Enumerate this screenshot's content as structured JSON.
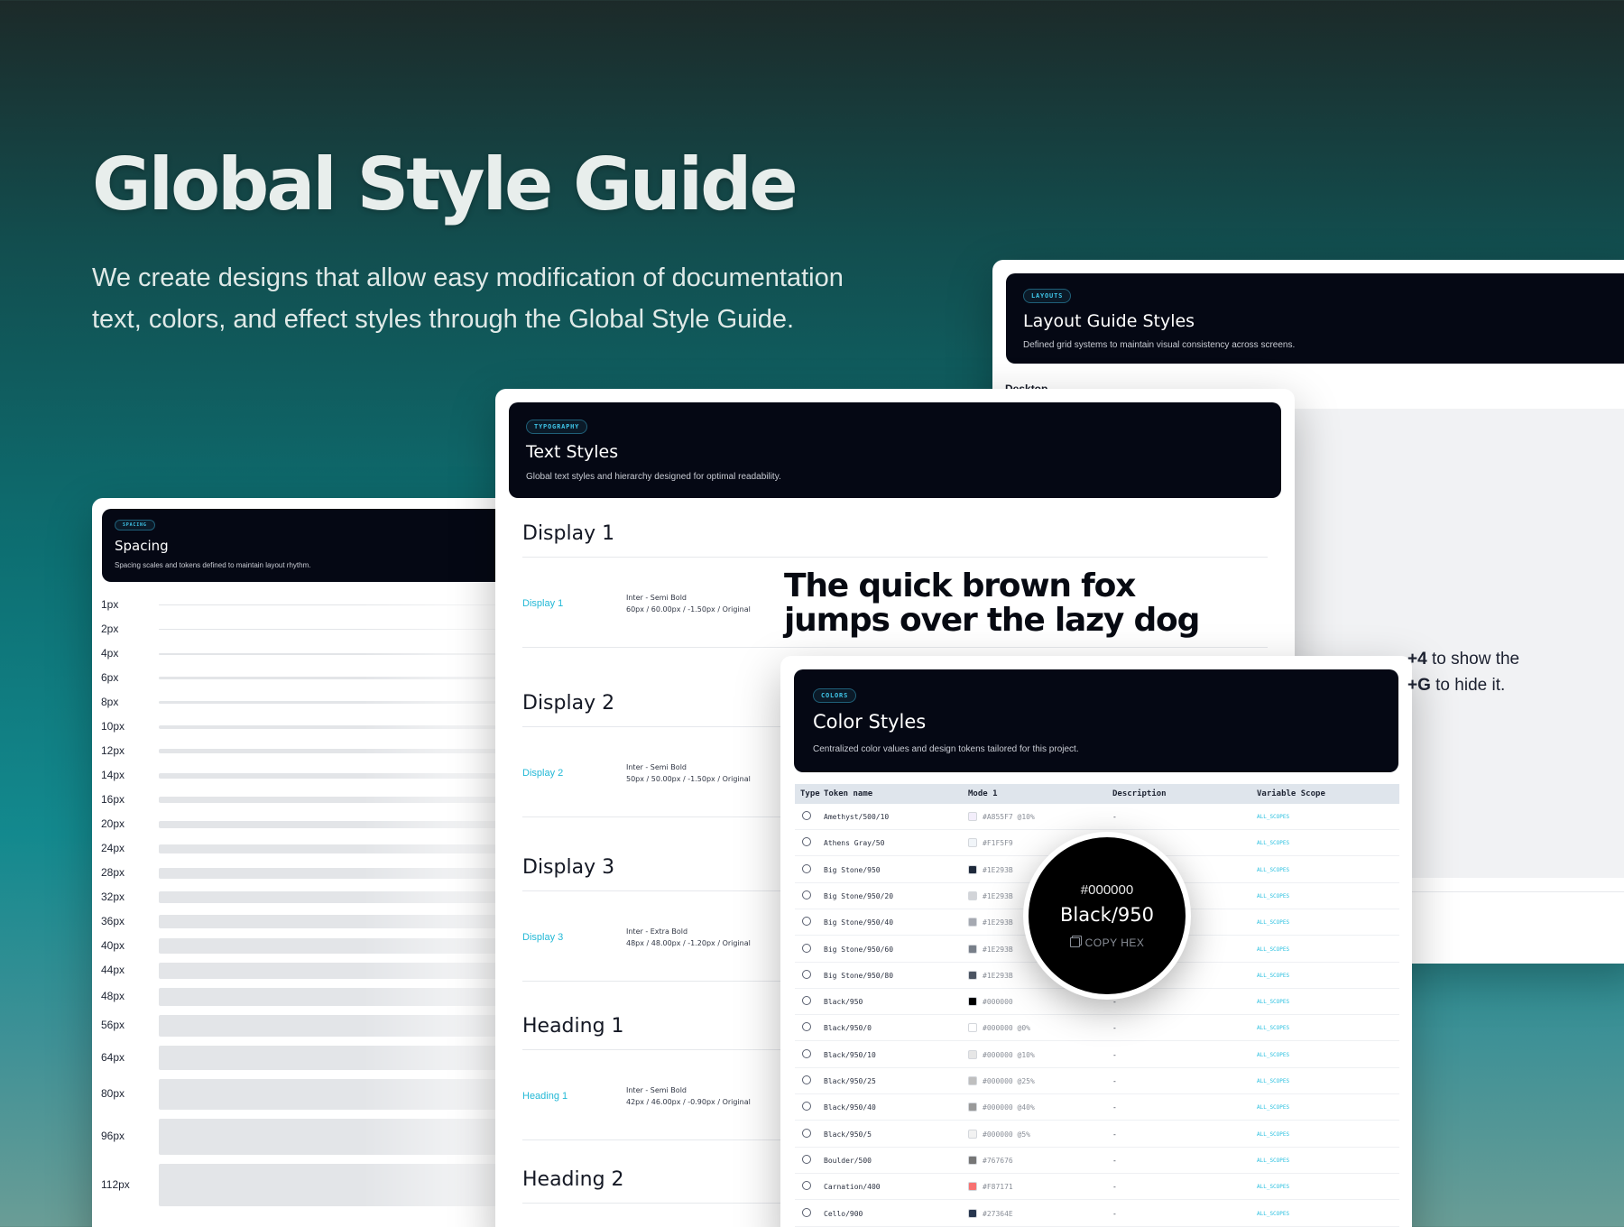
{
  "hero": {
    "title": "Global Style Guide",
    "subtitle_line1": "We create designs that allow easy modification of documentation",
    "subtitle_line2": "text, colors, and effect styles through the Global Style Guide."
  },
  "spacing_panel": {
    "tag": "SPACING",
    "title": "Spacing",
    "description": "Spacing scales and tokens defined to maintain layout rhythm.",
    "items": [
      "1px",
      "2px",
      "4px",
      "6px",
      "8px",
      "10px",
      "12px",
      "14px",
      "16px",
      "20px",
      "24px",
      "28px",
      "32px",
      "36px",
      "40px",
      "44px",
      "48px",
      "56px",
      "64px",
      "80px",
      "96px",
      "112px"
    ]
  },
  "layout_panel": {
    "tag": "LAYOUTS",
    "title": "Layout Guide Styles",
    "description": "Defined grid systems to maintain visual consistency across screens.",
    "section_label": "Desktop"
  },
  "text_panel": {
    "tag": "TYPOGRAPHY",
    "title": "Text Styles",
    "description": "Global text styles and hierarchy designed for optimal readability.",
    "sample": "The quick brown fox jumps over the lazy dog",
    "styles": [
      {
        "heading": "Display 1",
        "link": "Display 1",
        "font": "Inter - Semi Bold",
        "spec": "60px / 60.00px / -1.50px / Original"
      },
      {
        "heading": "Display 2",
        "link": "Display 2",
        "font": "Inter - Semi Bold",
        "spec": "50px / 50.00px / -1.50px / Original"
      },
      {
        "heading": "Display 3",
        "link": "Display 3",
        "font": "Inter - Extra Bold",
        "spec": "48px / 48.00px / -1.20px / Original"
      },
      {
        "heading": "Heading 1",
        "link": "Heading 1",
        "font": "Inter - Semi Bold",
        "spec": "42px / 46.00px / -0.90px / Original"
      },
      {
        "heading": "Heading 2",
        "link": "",
        "font": "",
        "spec": ""
      }
    ]
  },
  "color_panel": {
    "tag": "COLORS",
    "title": "Color Styles",
    "description": "Centralized color values and design tokens tailored for this project.",
    "columns": {
      "type": "Type",
      "token": "Token name",
      "mode": "Mode 1",
      "description": "Description",
      "scope": "Variable Scope"
    },
    "rows": [
      {
        "token": "Amethyst/500/10",
        "value": "#A855F7 @10%",
        "swatch": "#f3eefb",
        "desc": "-",
        "scope": "ALL_SCOPES"
      },
      {
        "token": "Athens Gray/50",
        "value": "#F1F5F9",
        "swatch": "#F1F5F9",
        "desc": "-",
        "scope": "ALL_SCOPES"
      },
      {
        "token": "Big Stone/950",
        "value": "#1E293B",
        "swatch": "#1E293B",
        "desc": "-",
        "scope": "ALL_SCOPES"
      },
      {
        "token": "Big Stone/950/20",
        "value": "#1E293B",
        "swatch": "#d2d4d8",
        "desc": "-",
        "scope": "ALL_SCOPES"
      },
      {
        "token": "Big Stone/950/40",
        "value": "#1E293B",
        "swatch": "#a5a9b1",
        "desc": "-",
        "scope": "ALL_SCOPES"
      },
      {
        "token": "Big Stone/950/60",
        "value": "#1E293B",
        "swatch": "#787f89",
        "desc": "-",
        "scope": "ALL_SCOPES"
      },
      {
        "token": "Big Stone/950/80",
        "value": "#1E293B",
        "swatch": "#4b5462",
        "desc": "-",
        "scope": "ALL_SCOPES"
      },
      {
        "token": "Black/950",
        "value": "#000000",
        "swatch": "#000000",
        "desc": "-",
        "scope": "ALL_SCOPES"
      },
      {
        "token": "Black/950/0",
        "value": "#000000 @0%",
        "swatch": "#ffffff",
        "desc": "-",
        "scope": "ALL_SCOPES"
      },
      {
        "token": "Black/950/10",
        "value": "#000000 @10%",
        "swatch": "#e6e6e6",
        "desc": "-",
        "scope": "ALL_SCOPES"
      },
      {
        "token": "Black/950/25",
        "value": "#000000 @25%",
        "swatch": "#bfbfbf",
        "desc": "-",
        "scope": "ALL_SCOPES"
      },
      {
        "token": "Black/950/40",
        "value": "#000000 @40%",
        "swatch": "#999999",
        "desc": "-",
        "scope": "ALL_SCOPES"
      },
      {
        "token": "Black/950/5",
        "value": "#000000 @5%",
        "swatch": "#f2f2f2",
        "desc": "-",
        "scope": "ALL_SCOPES"
      },
      {
        "token": "Boulder/500",
        "value": "#767676",
        "swatch": "#767676",
        "desc": "-",
        "scope": "ALL_SCOPES"
      },
      {
        "token": "Carnation/400",
        "value": "#F87171",
        "swatch": "#F87171",
        "desc": "-",
        "scope": "ALL_SCOPES"
      },
      {
        "token": "Cello/900",
        "value": "#27364E",
        "swatch": "#27364E",
        "desc": "-",
        "scope": "ALL_SCOPES"
      }
    ]
  },
  "tooltip": {
    "hex": "#000000",
    "name": "Black/950",
    "copy_label": "COPY HEX"
  },
  "hint": {
    "line1_key": "+4",
    "line1_text": " to show the",
    "line2_key": "+G",
    "line2_text": " to hide it."
  }
}
